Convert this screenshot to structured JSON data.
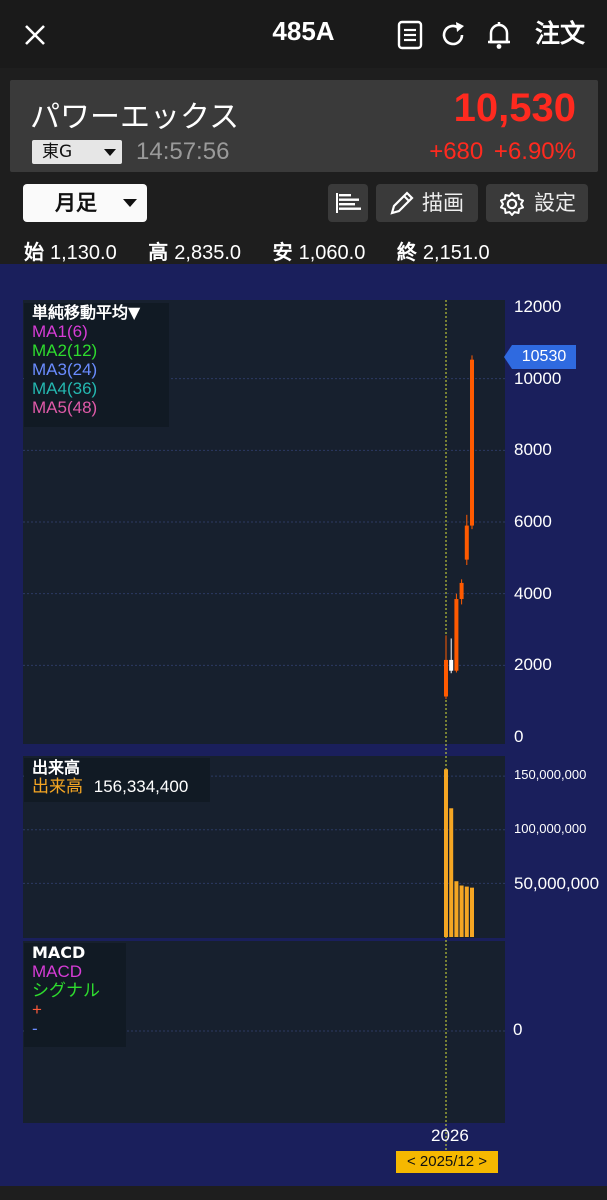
{
  "header": {
    "ticker": "485A",
    "order_label": "注文"
  },
  "stock": {
    "name": "パワーエックス",
    "price": "10,530",
    "market": "東G",
    "time": "14:57:56",
    "change": "+680",
    "change_pct": "+6.90%"
  },
  "controls": {
    "period": "月足",
    "draw_label": "描画",
    "settings_label": "設定"
  },
  "ohlc": {
    "open_label": "始",
    "open": "1,130.0",
    "high_label": "高",
    "high": "2,835.0",
    "low_label": "安",
    "low": "1,060.0",
    "close_label": "終",
    "close": "2,151.0"
  },
  "legends": {
    "ma_title": "単純移動平均▼",
    "ma_items": [
      "MA1(6)",
      "MA2(12)",
      "MA3(24)",
      "MA4(36)",
      "MA5(48)"
    ],
    "ma_colors": [
      "#d63cd6",
      "#2edc2e",
      "#6a8cff",
      "#24b8b0",
      "#e05aa8"
    ],
    "volume_title": "出来高",
    "volume_label": "出来高",
    "volume_value": "156,334,400",
    "macd_title": "MACD",
    "macd_items": [
      "MACD",
      "シグナル",
      "+",
      "-"
    ],
    "macd_colors": [
      "#d63cd6",
      "#2edc2e",
      "#ff5a3a",
      "#6a8cff"
    ]
  },
  "chart_data": [
    {
      "type": "candlestick",
      "title": "",
      "ylim": [
        0,
        12000
      ],
      "yticks": [
        "12000",
        "10000",
        "8000",
        "6000",
        "4000",
        "2000",
        "0"
      ],
      "last_price": "10530",
      "candles": [
        {
          "o": 1130,
          "h": 2835,
          "l": 1060,
          "c": 2151
        },
        {
          "o": 2151,
          "h": 2750,
          "l": 1780,
          "c": 1850
        },
        {
          "o": 1850,
          "h": 4000,
          "l": 1800,
          "c": 3850
        },
        {
          "o": 3850,
          "h": 4400,
          "l": 3700,
          "c": 4300
        },
        {
          "o": 4950,
          "h": 6200,
          "l": 4800,
          "c": 5900
        },
        {
          "o": 5900,
          "h": 10650,
          "l": 5800,
          "c": 10530
        }
      ],
      "colors": {
        "up": "#ff5a00",
        "flat": "#ffffff"
      }
    },
    {
      "type": "bar",
      "title": "出来高",
      "ylim": [
        0,
        165000000
      ],
      "yticks": [
        "150,000,000",
        "100,000,000",
        "50,000,000"
      ],
      "values": [
        156334400,
        120000000,
        52000000,
        48000000,
        47000000,
        46000000
      ],
      "color": "#f5a623"
    },
    {
      "type": "line",
      "title": "MACD",
      "yticks": [
        "0"
      ],
      "x_label": "2026",
      "cursor_date": "< 2025/12 >"
    }
  ]
}
